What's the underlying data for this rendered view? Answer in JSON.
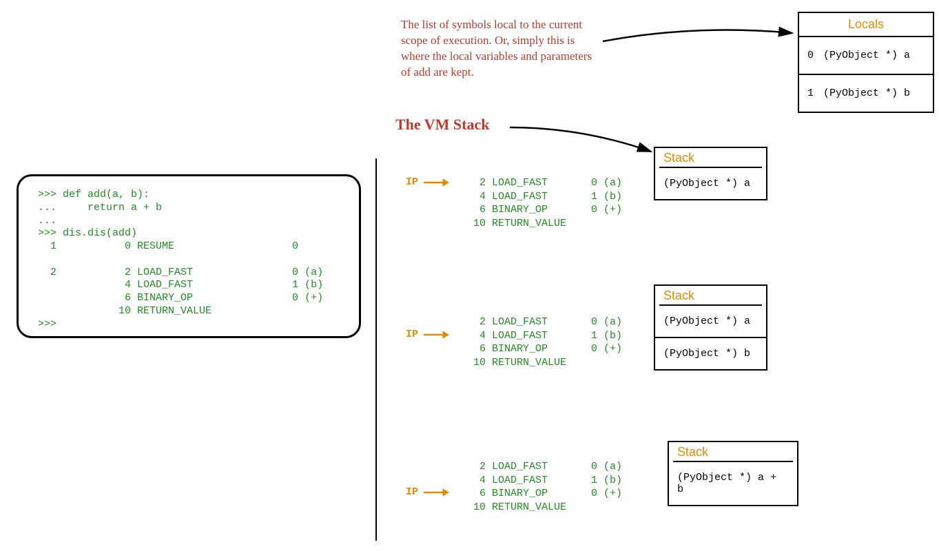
{
  "code_box": ">>> def add(a, b):\n...     return a + b\n...\n>>> dis.dis(add)\n  1           0 RESUME                   0\n\n  2           2 LOAD_FAST                0 (a)\n              4 LOAD_FAST                1 (b)\n              6 BINARY_OP                0 (+)\n             10 RETURN_VALUE\n>>>",
  "locals_caption": "The list of symbols local to the current scope of execution. Or, simply this is where the local variables and parameters of add are kept.",
  "vm_title": "The VM Stack",
  "locals_table": {
    "header": "Locals",
    "rows": [
      {
        "idx": "0",
        "val": "(PyObject *) a"
      },
      {
        "idx": "1",
        "val": "(PyObject *) b"
      }
    ]
  },
  "bytecode_block": "    2 LOAD_FAST       0 (a)\n    4 LOAD_FAST       1 (b)\n    6 BINARY_OP       0 (+)\n   10 RETURN_VALUE",
  "ip_label": "IP",
  "stacks": {
    "s1": {
      "header": "Stack",
      "cells": [
        "(PyObject *) a"
      ]
    },
    "s2": {
      "header": "Stack",
      "cells": [
        "(PyObject *) a",
        "(PyObject *) b"
      ]
    },
    "s3": {
      "header": "Stack",
      "cells": [
        "(PyObject *) a + b"
      ]
    }
  }
}
